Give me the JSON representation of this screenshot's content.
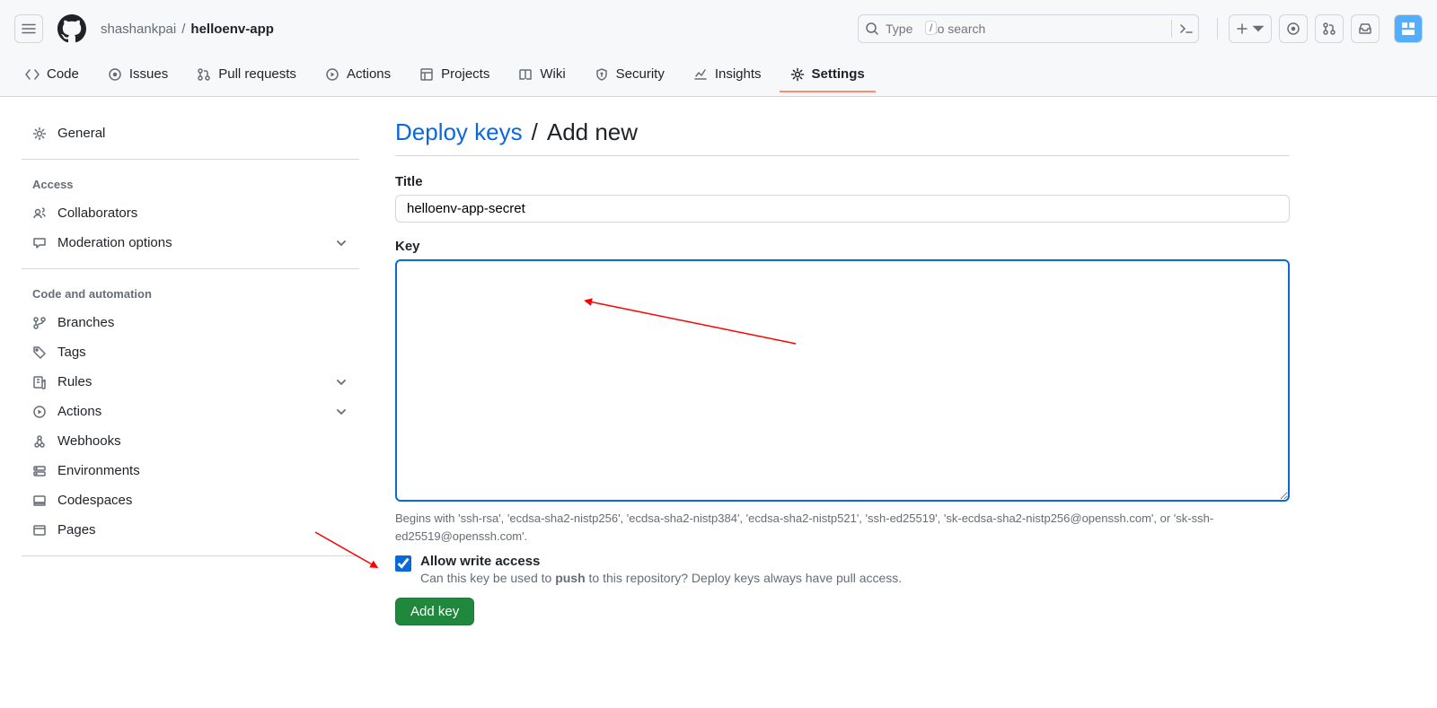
{
  "header": {
    "owner": "shashankpai",
    "repo": "helloenv-app",
    "search_placeholder_prefix": "Type ",
    "search_kbd": "/",
    "search_placeholder_suffix": " to search"
  },
  "repo_nav": [
    {
      "label": "Code",
      "icon": "code"
    },
    {
      "label": "Issues",
      "icon": "issue"
    },
    {
      "label": "Pull requests",
      "icon": "pr"
    },
    {
      "label": "Actions",
      "icon": "play"
    },
    {
      "label": "Projects",
      "icon": "project"
    },
    {
      "label": "Wiki",
      "icon": "book"
    },
    {
      "label": "Security",
      "icon": "shield"
    },
    {
      "label": "Insights",
      "icon": "graph"
    },
    {
      "label": "Settings",
      "icon": "gear",
      "selected": true
    }
  ],
  "sidebar": {
    "general": "General",
    "access_heading": "Access",
    "collaborators": "Collaborators",
    "moderation": "Moderation options",
    "code_heading": "Code and automation",
    "branches": "Branches",
    "tags": "Tags",
    "rules": "Rules",
    "actions": "Actions",
    "webhooks": "Webhooks",
    "environments": "Environments",
    "codespaces": "Codespaces",
    "pages": "Pages"
  },
  "content": {
    "title_link": "Deploy keys",
    "title_sep": "/",
    "title_tail": "Add new",
    "title_label": "Title",
    "title_value": "helloenv-app-secret",
    "key_label": "Key",
    "key_value": "",
    "key_note": "Begins with 'ssh-rsa', 'ecdsa-sha2-nistp256', 'ecdsa-sha2-nistp384', 'ecdsa-sha2-nistp521', 'ssh-ed25519', 'sk-ecdsa-sha2-nistp256@openssh.com', or 'sk-ssh-ed25519@openssh.com'.",
    "allow_write_label": "Allow write access",
    "allow_write_checked": true,
    "allow_write_desc_pre": "Can this key be used to ",
    "allow_write_desc_bold": "push",
    "allow_write_desc_post": " to this repository? Deploy keys always have pull access.",
    "submit_label": "Add key"
  }
}
